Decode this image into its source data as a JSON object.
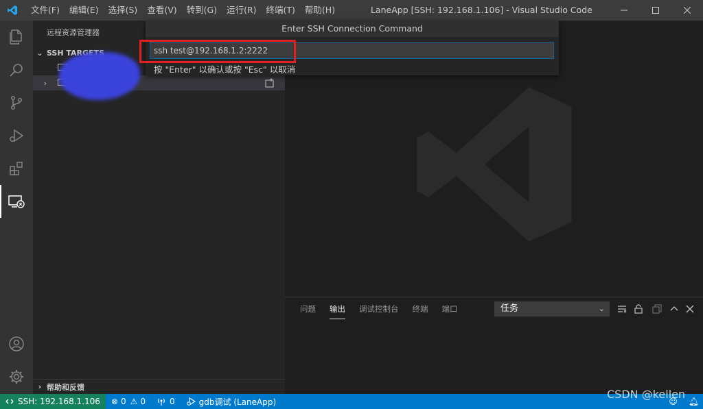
{
  "titlebar": {
    "logo_icon": "vscode-logo-icon",
    "menu": [
      "文件(F)",
      "编辑(E)",
      "选择(S)",
      "查看(V)",
      "转到(G)",
      "运行(R)",
      "终端(T)",
      "帮助(H)"
    ],
    "title": "LaneApp [SSH: 192.168.1.106] - Visual Studio Code"
  },
  "activitybar": {
    "icons": [
      "explorer-icon",
      "search-icon",
      "source-control-icon",
      "run-debug-icon",
      "extensions-icon",
      "remote-explorer-icon",
      "account-icon",
      "settings-gear-icon"
    ],
    "active": "remote-explorer-icon"
  },
  "sidebar": {
    "title": "远程资源管理器",
    "section": "SSH TARGETS",
    "help_section": "帮助和反馈"
  },
  "quick_input": {
    "title": "Enter SSH Connection Command",
    "value": "ssh test@192.168.1.2:2222",
    "hint": "按 \"Enter\" 以确认或按 \"Esc\" 以取消"
  },
  "panel": {
    "tabs": [
      "问题",
      "输出",
      "调试控制台",
      "终端",
      "端口"
    ],
    "active_tab": "输出",
    "task_select": "任务"
  },
  "statusbar": {
    "remote": "SSH: 192.168.1.106",
    "errors": "0",
    "warnings": "0",
    "ports": "0",
    "debug": "gdb调试 (LaneApp)"
  },
  "watermark": "CSDN @kellen",
  "colors": {
    "accent": "#007acc",
    "remote_badge": "#16825d",
    "highlight_box": "#e02020"
  }
}
